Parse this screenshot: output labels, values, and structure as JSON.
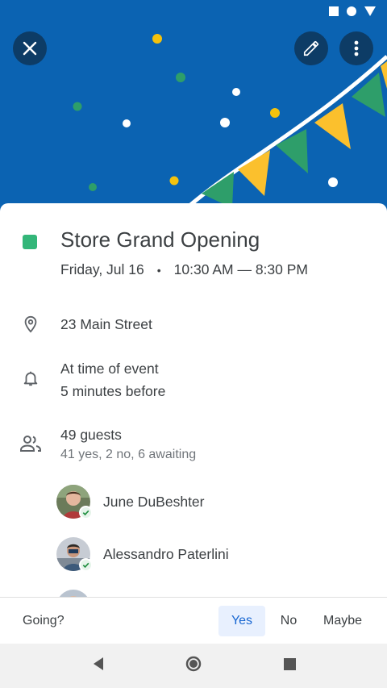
{
  "status_bar": {
    "icons": [
      "square-icon",
      "circle-icon",
      "triangle-signal-icon"
    ]
  },
  "header": {
    "close_icon": "close-icon",
    "edit_icon": "pencil-icon",
    "more_icon": "more-vert-icon",
    "colors": {
      "background": "#0b63b2",
      "button": "#0d3c66",
      "flag_yellow": "#fbc02d",
      "flag_green": "#2e9e6a"
    }
  },
  "event": {
    "title": "Store Grand Opening",
    "date": "Friday, Jul 16",
    "bullet": "•",
    "time": "10:30 AM — 8:30 PM",
    "color": "#33b679"
  },
  "location": {
    "icon": "location-pin-icon",
    "text": "23 Main Street"
  },
  "reminders": {
    "icon": "bell-icon",
    "items": [
      "At time of event",
      "5 minutes before"
    ]
  },
  "guests": {
    "icon": "people-icon",
    "count_label": "49 guests",
    "summary": "41 yes, 2 no, 6 awaiting",
    "list": [
      {
        "name": "June DuBeshter",
        "status": "yes"
      },
      {
        "name": "Alessandro Paterlini",
        "status": "yes"
      },
      {
        "name": "",
        "status": ""
      }
    ]
  },
  "rsvp": {
    "question": "Going?",
    "options": [
      "Yes",
      "No",
      "Maybe"
    ],
    "selected": "Yes"
  },
  "nav": {
    "icons": [
      "back-icon",
      "home-icon",
      "recents-icon"
    ]
  }
}
